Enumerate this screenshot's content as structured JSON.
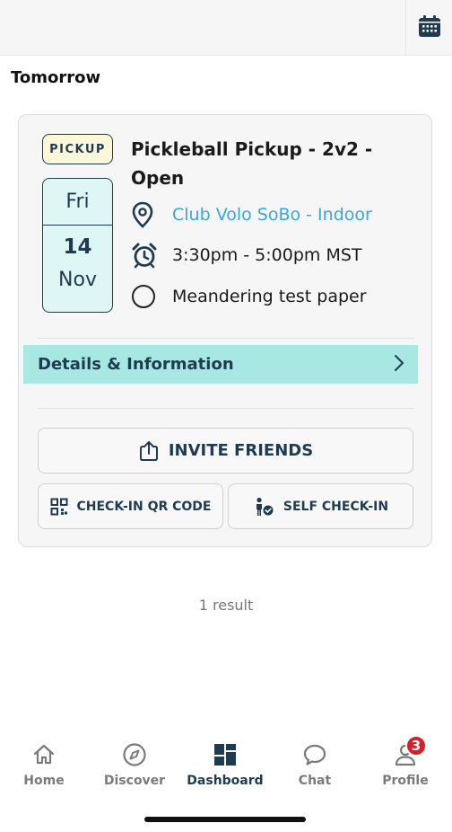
{
  "header": {
    "calendar_icon": "calendar-icon"
  },
  "section": {
    "title": "Tomorrow"
  },
  "event": {
    "badge": "PICKUP",
    "date": {
      "weekday": "Fri",
      "day": "14",
      "month": "Nov"
    },
    "title": "Pickleball Pickup - 2v2 - Open",
    "location": "Club Volo SoBo - Indoor",
    "time": "3:30pm - 5:00pm MST",
    "status": "Meandering test paper",
    "details_label": "Details & Information",
    "invite_label": "INVITE FRIENDS",
    "qr_label": "CHECK-IN QR CODE",
    "self_checkin_label": "SELF CHECK-IN"
  },
  "results_text": "1 result",
  "nav": {
    "items": [
      {
        "label": "Home",
        "icon": "home-icon"
      },
      {
        "label": "Discover",
        "icon": "compass-icon"
      },
      {
        "label": "Dashboard",
        "icon": "dashboard-icon"
      },
      {
        "label": "Chat",
        "icon": "chat-icon"
      },
      {
        "label": "Profile",
        "icon": "profile-icon",
        "badge": "3"
      }
    ],
    "active": "Dashboard"
  },
  "colors": {
    "navy": "#1f3b52",
    "accent_teal": "#a8e8e2",
    "link_blue": "#3aa6dc",
    "badge_red": "#d91f2a",
    "pickup_yellow": "#fbf8d9",
    "date_bg": "#dff7f4"
  }
}
